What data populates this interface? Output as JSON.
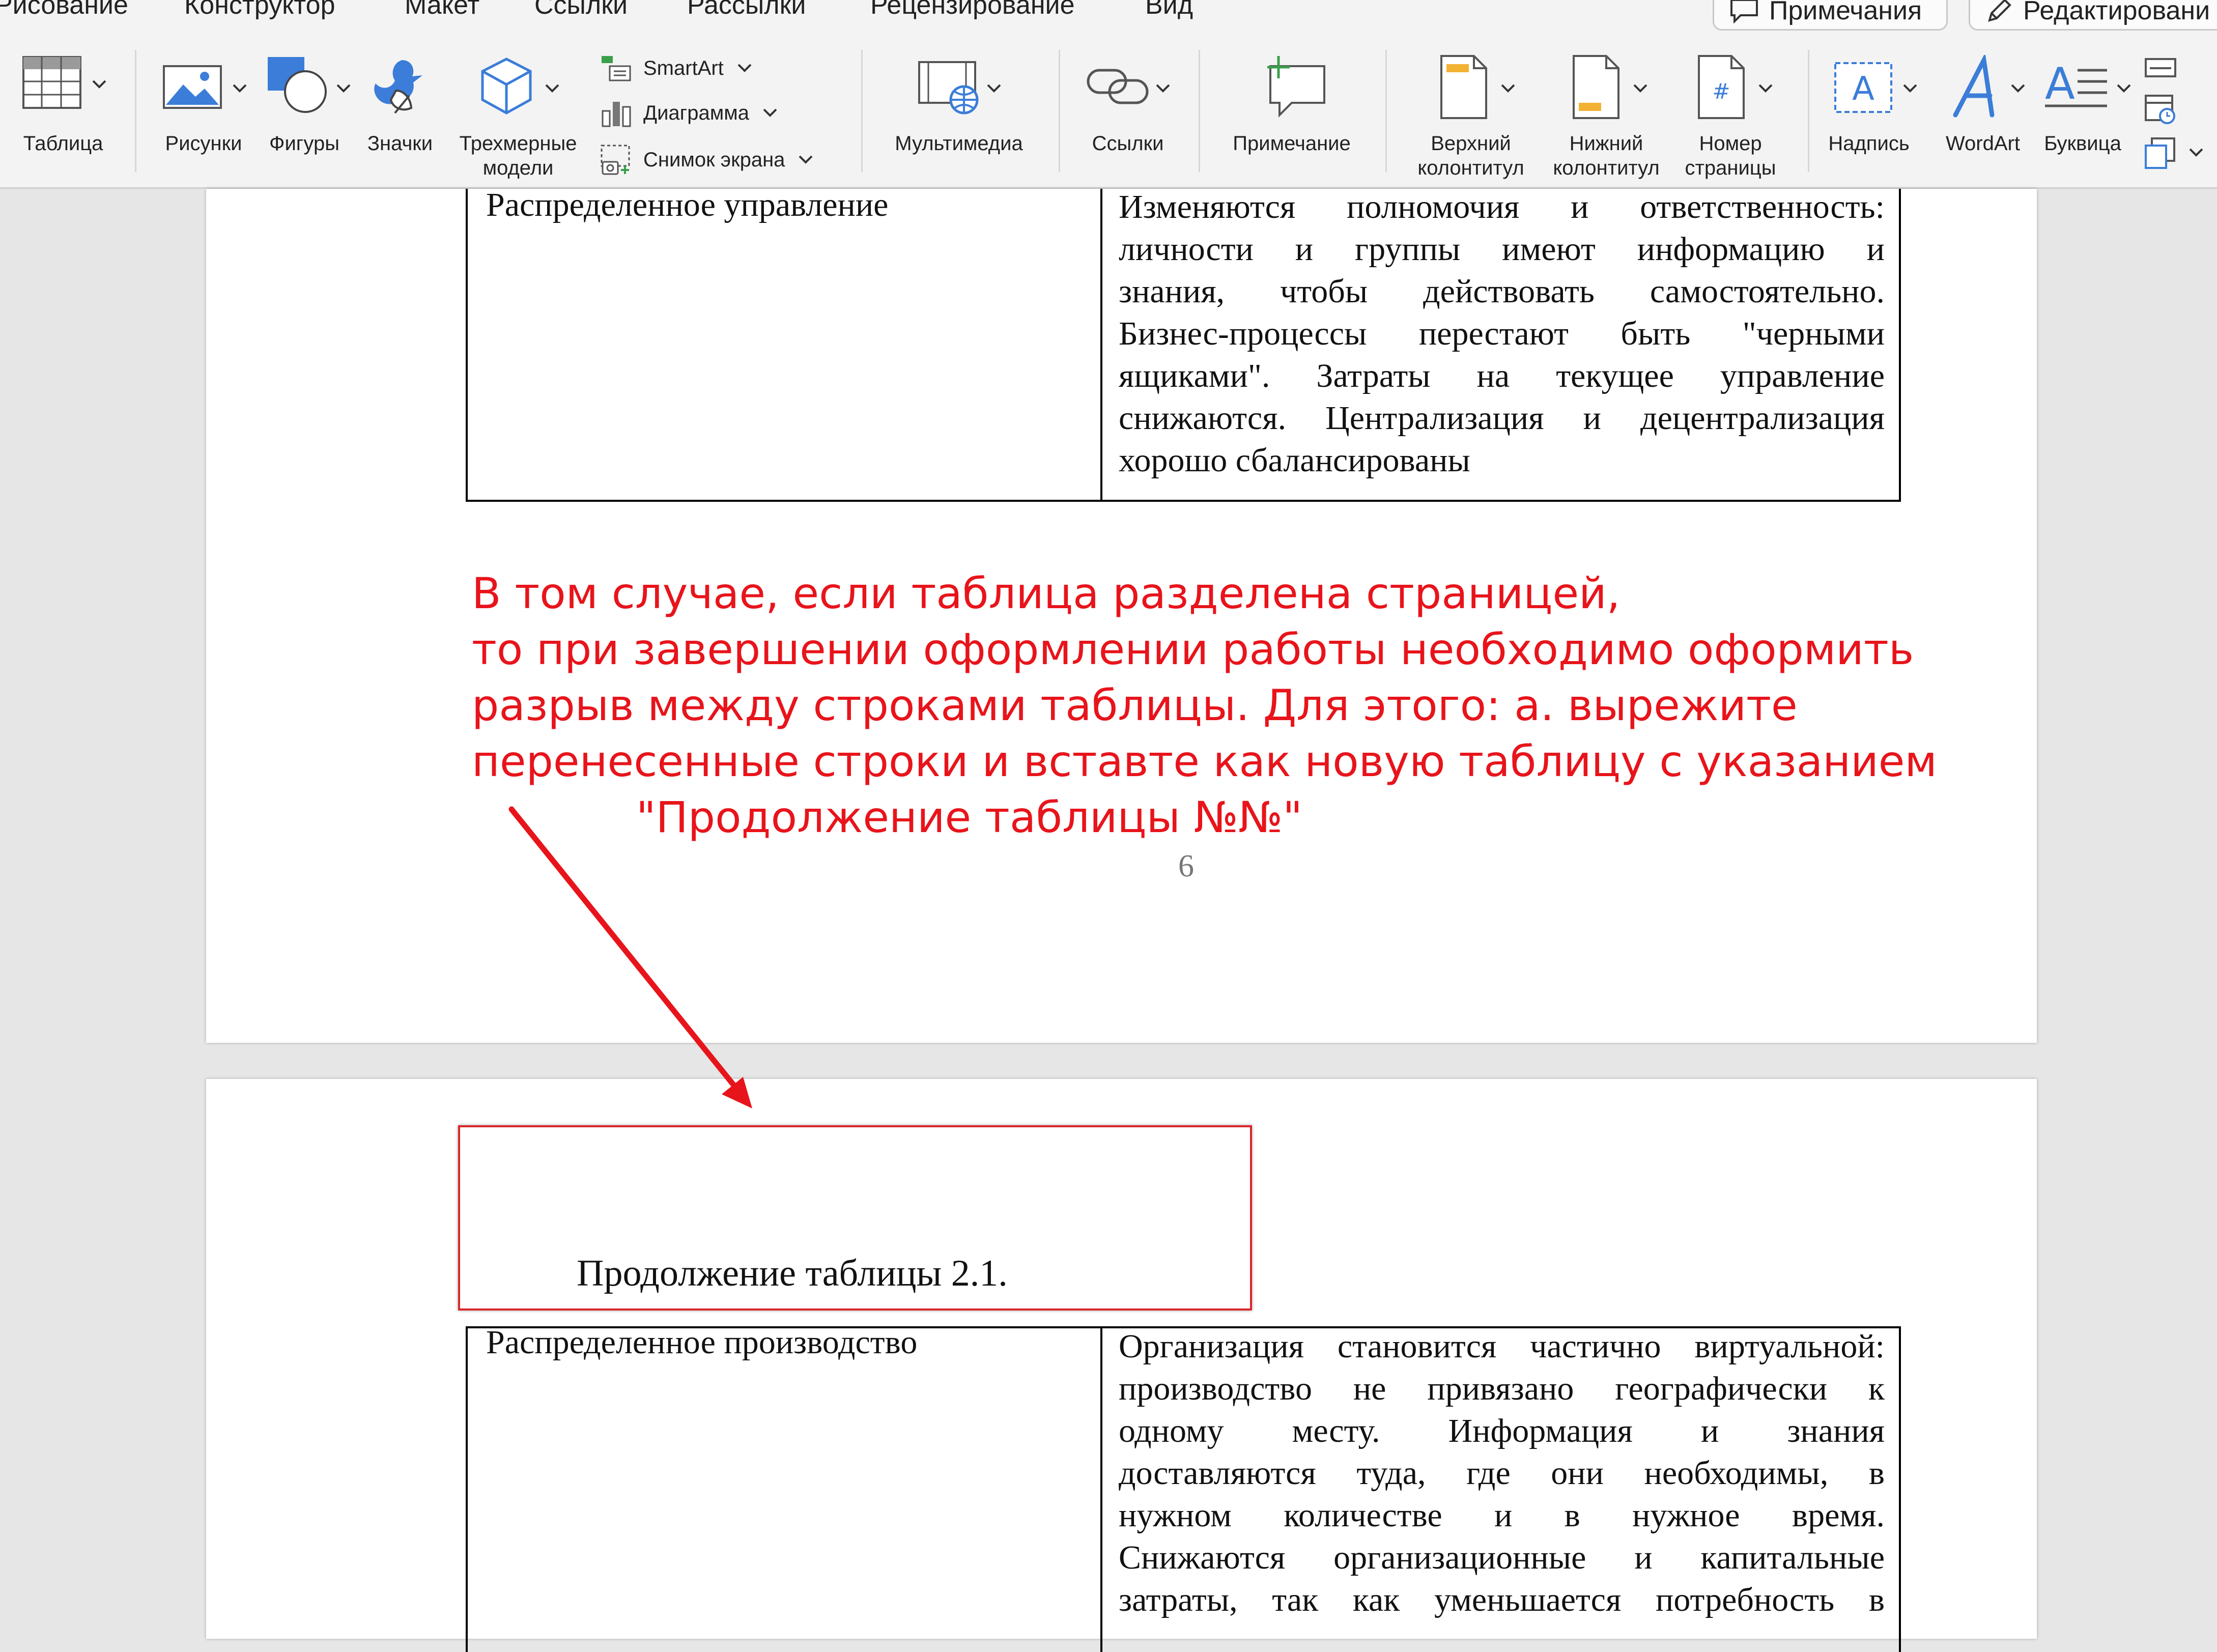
{
  "menu": {
    "tabs": [
      "Рисование",
      "Конструктор",
      "Макет",
      "Ссылки",
      "Рассылки",
      "Рецензирование",
      "Вид"
    ],
    "comments_button": "Примечания",
    "editing_button": "Редактировани"
  },
  "ribbon": {
    "table": "Таблица",
    "pictures": "Рисунки",
    "shapes": "Фигуры",
    "icons": "Значки",
    "models_line1": "Трехмерные",
    "models_line2": "модели",
    "smartart": "SmartArt",
    "chart": "Диаграмма",
    "screenshot": "Снимок экрана",
    "media": "Мультимедиа",
    "links": "Ссылки",
    "comment": "Примечание",
    "header_line1": "Верхний",
    "header_line2": "колонтитул",
    "footer_line1": "Нижний",
    "footer_line2": "колонтитул",
    "pagenum_line1": "Номер",
    "pagenum_line2": "страницы",
    "textbox": "Надпись",
    "wordart": "WordArt",
    "dropcap": "Буквица"
  },
  "page1": {
    "left_cell": "Распределенное  управление",
    "right_cell_lines": [
      "Изменяются полномочия и ответственность:",
      "личности и группы имеют информацию и",
      "знания, чтобы действовать самостоятельно.",
      "Бизнес-процессы перестают быть \"черными",
      "ящиками\". Затраты на текущее управление",
      "снижаются. Централизация и децентрализация",
      "хорошо сбалансированы"
    ],
    "page_number": "6"
  },
  "annotation": {
    "lines": [
      "В том случае, если таблица разделена страницей,",
      "то при завершении оформлении работы необходимо оформить",
      "разрыв между строками таблицы. Для этого: а. вырежите",
      "перенесенные строки и вставте как новую таблицу с указанием",
      "\"Продолжение таблицы №№\""
    ],
    "color": "#e8141b"
  },
  "page2": {
    "caption": "Продолжение таблицы 2.1.",
    "left_cell": "Распределенное  производство",
    "right_cell_lines": [
      "Организация становится частично виртуальной:",
      "производство не привязано географически к",
      "одному месту. Информация и знания",
      "доставляются туда, где они необходимы, в",
      "нужном количестве и в нужное время.",
      "Снижаются организационные и капитальные",
      "затраты, так как уменьшается потребность в"
    ]
  }
}
